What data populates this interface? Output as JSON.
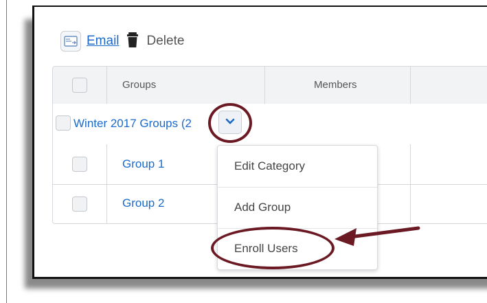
{
  "toolbar": {
    "email_label": "Email",
    "delete_label": "Delete"
  },
  "table": {
    "columns": [
      "Groups",
      "Members"
    ],
    "category_label": "Winter 2017 Groups (2",
    "rows": [
      {
        "name": "Group 1"
      },
      {
        "name": "Group 2"
      }
    ]
  },
  "menu": {
    "items": [
      "Edit Category",
      "Add Group",
      "Enroll Users"
    ]
  },
  "colors": {
    "link": "#1b6ac9",
    "annotation": "#6b1a24"
  },
  "icons": [
    "email-icon",
    "trash-icon",
    "chevron-down-icon",
    "annotation-arrow-icon"
  ]
}
